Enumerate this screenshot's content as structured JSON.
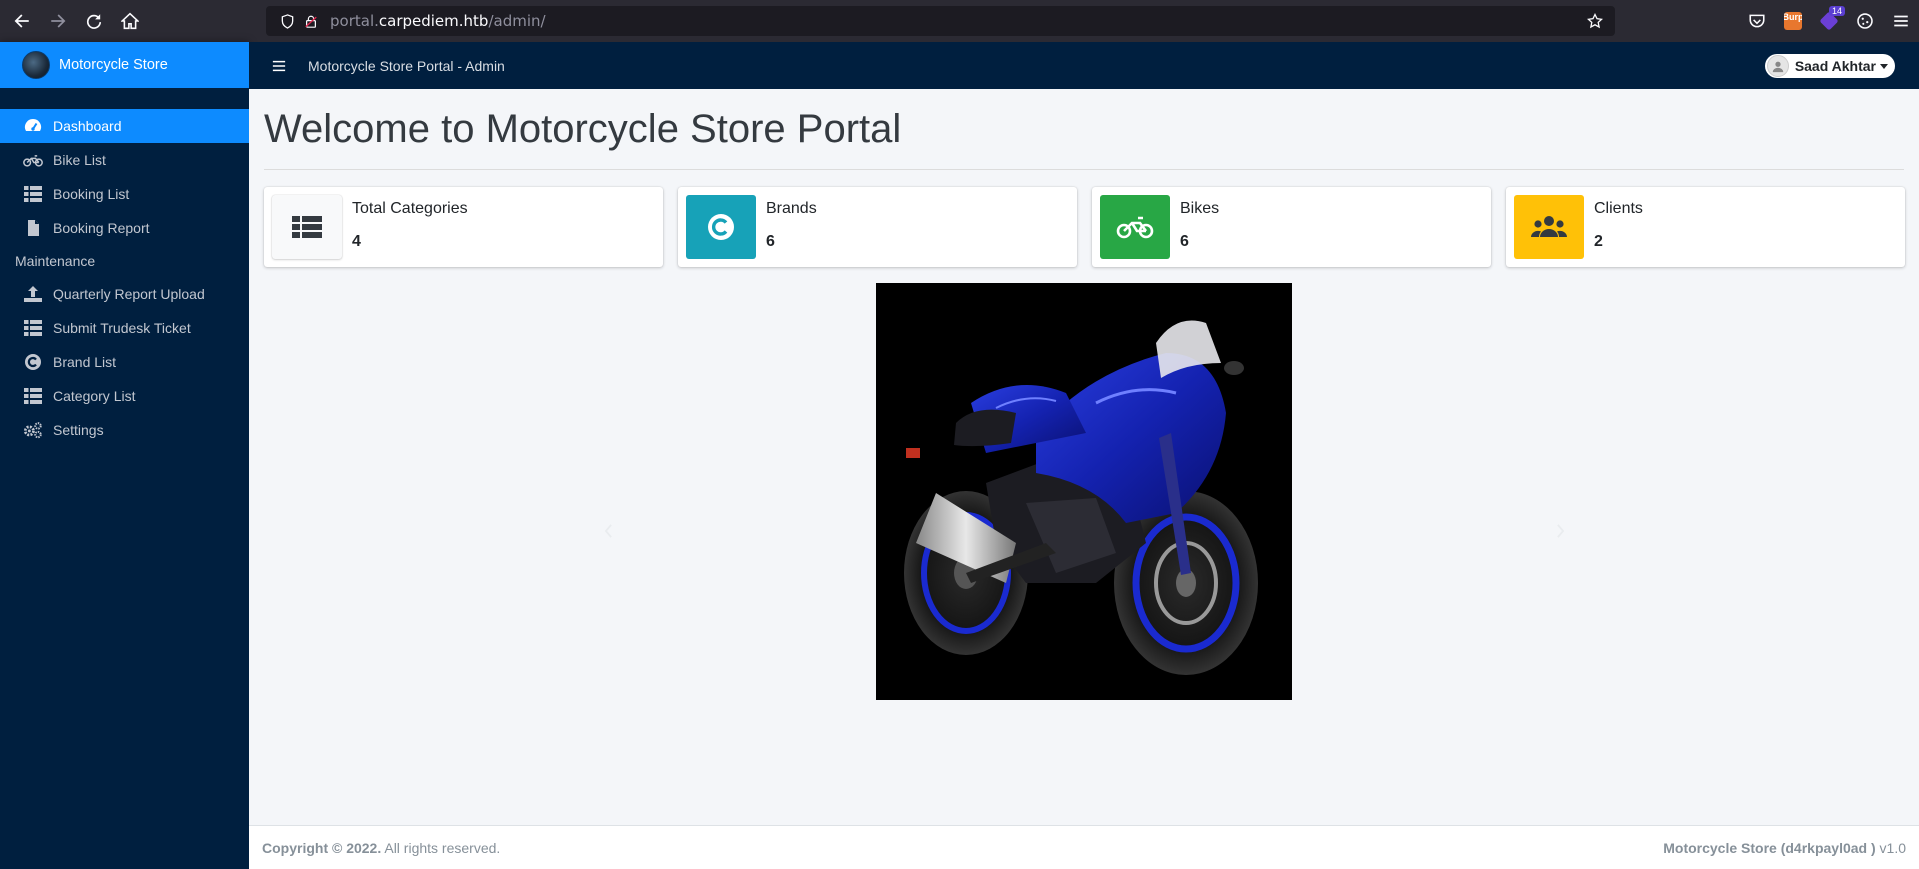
{
  "browser": {
    "url_prefix": "portal.",
    "url_host": "carpediem.htb",
    "url_path": "/admin/",
    "ext_burp_label": "Burp",
    "ext_badge_count": "14"
  },
  "sidebar": {
    "brand": "Motorcycle Store",
    "items": [
      {
        "label": "Dashboard",
        "icon": "tachometer-icon",
        "active": true
      },
      {
        "label": "Bike List",
        "icon": "motorcycle-icon"
      },
      {
        "label": "Booking List",
        "icon": "list-icon"
      },
      {
        "label": "Booking Report",
        "icon": "file-icon"
      }
    ],
    "section_header": "Maintenance",
    "maintenance_items": [
      {
        "label": "Quarterly Report Upload",
        "icon": "upload-icon"
      },
      {
        "label": "Submit Trudesk Ticket",
        "icon": "list-icon"
      },
      {
        "label": "Brand List",
        "icon": "copyright-icon"
      },
      {
        "label": "Category List",
        "icon": "list-icon"
      },
      {
        "label": "Settings",
        "icon": "cogs-icon"
      }
    ]
  },
  "topnav": {
    "title": "Motorcycle Store Portal - Admin",
    "user_name": "Saad Akhtar"
  },
  "main": {
    "title": "Welcome to Motorcycle Store Portal",
    "info_boxes": [
      {
        "label": "Total Categories",
        "value": "4",
        "icon": "th-list-icon",
        "color": "#f8f9fa"
      },
      {
        "label": "Brands",
        "value": "6",
        "icon": "copyright-icon",
        "color": "#17a2b8"
      },
      {
        "label": "Bikes",
        "value": "6",
        "icon": "motorcycle-icon",
        "color": "#28a745"
      },
      {
        "label": "Clients",
        "value": "2",
        "icon": "users-icon",
        "color": "#ffc107"
      }
    ],
    "carousel_image": "blue-sport-motorcycle"
  },
  "footer": {
    "copyright_bold": "Copyright © 2022.",
    "copyright_rest": " All rights reserved.",
    "right_bold": "Motorcycle Store (d4rkpayl0ad )",
    "version": " v1.0"
  },
  "colors": {
    "sidebar_bg": "#001f3f",
    "accent": "#0d8bff",
    "content_bg": "#f4f6f9"
  }
}
